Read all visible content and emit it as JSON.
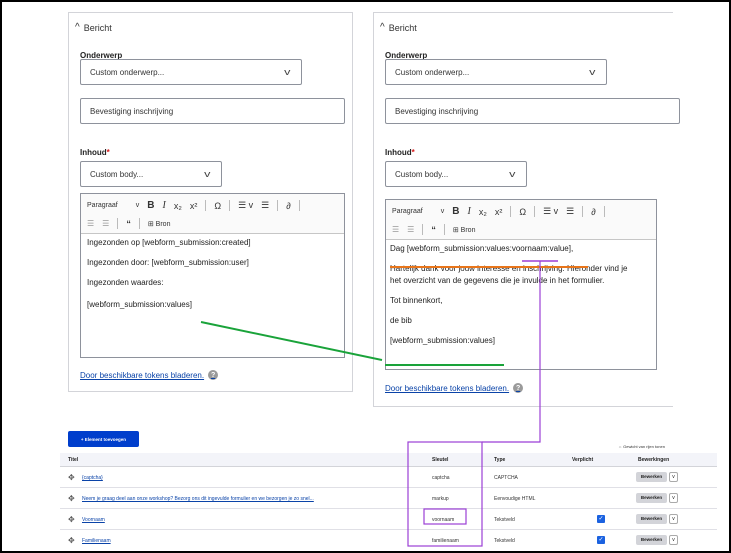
{
  "left_panel": {
    "summary_title": "Bericht",
    "subject_label": "Onderwerp",
    "subject_select": "Custom onderwerp...",
    "subject_value": "Bevestiging inschrijving",
    "body_label": "Inhoud",
    "required_mark": "*",
    "body_select": "Custom body...",
    "toolbar": {
      "format_label": "Paragraaf",
      "source_label": "Bron"
    },
    "body_lines": [
      "Ingezonden op [webform_submission:created]",
      "Ingezonden door: [webform_submission:user]",
      "Ingezonden waardes:",
      "[webform_submission:values]"
    ],
    "tokens_link": "Door beschikbare tokens bladeren.",
    "help_icon": "?"
  },
  "right_panel": {
    "summary_title": "Bericht",
    "subject_label": "Onderwerp",
    "subject_select": "Custom onderwerp...",
    "subject_value": "Bevestiging inschrijving",
    "body_label": "Inhoud",
    "required_mark": "*",
    "body_select": "Custom body...",
    "toolbar": {
      "format_label": "Paragraaf",
      "source_label": "Bron"
    },
    "body_lines": [
      "Dag [webform_submission:values:voornaam:value],",
      "Hartelijk dank voor jouw interesse en inschrijving. Hieronder vind je",
      "het overzicht van de gegevens die je invulde in het formulier.",
      "Tot binnenkort,",
      "de bib",
      "[webform_submission:values]"
    ],
    "tokens_link": "Door beschikbare tokens bladeren.",
    "help_icon": "?"
  },
  "elements": {
    "add_button": "+ Element toevoegen",
    "weight_link": "⇔ Gewicht van rijen tonen",
    "columns": [
      "Titel",
      "Sleutel",
      "Type",
      "Verplicht",
      "Bewerkingen"
    ],
    "rows": [
      {
        "title": "{captcha}",
        "key": "captcha",
        "type": "CAPTCHA",
        "required": false,
        "op": "Bewerken"
      },
      {
        "title": "Neem je graag deel aan onze workshop? Bezorg ons dit ingevulde formulier en we bezorgen je zo snel...",
        "key": "markup",
        "type": "Eenvoudige HTML",
        "required": false,
        "op": "Bewerken"
      },
      {
        "title": "Voornaam",
        "key": "voornaam",
        "type": "Tekstveld",
        "required": true,
        "op": "Bewerken"
      },
      {
        "title": "Familienaam",
        "key": "familienaam",
        "type": "Tekstveld",
        "required": true,
        "op": "Bewerken"
      }
    ]
  },
  "colors": {
    "annotation_green": "#1aa33a",
    "annotation_purple": "#9b3fd6",
    "annotation_orange": "#e8751a",
    "link_blue": "#0a43a8",
    "primary_button": "#003ecc"
  }
}
